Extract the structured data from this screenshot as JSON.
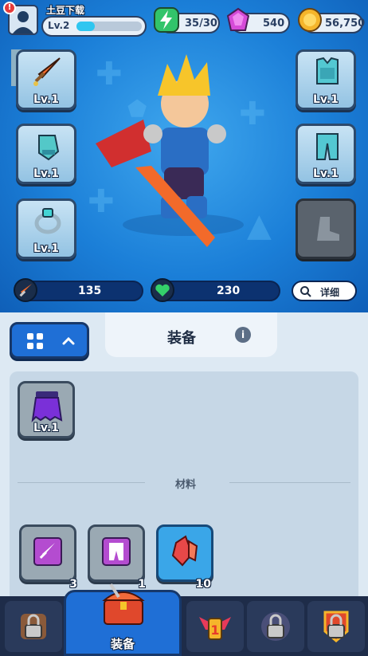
{
  "player": {
    "name": "土豆下载",
    "level_label": "Lv.2",
    "xp_fraction": 0.28,
    "alert_badge": "!"
  },
  "resources": {
    "energy": "35/30",
    "gems": "540",
    "coins": "56,750"
  },
  "equipment_left": [
    {
      "name": "sword",
      "level": "Lv.1"
    },
    {
      "name": "gloves",
      "level": "Lv.1"
    },
    {
      "name": "ring",
      "level": "Lv.1"
    }
  ],
  "equipment_right": [
    {
      "name": "armor",
      "level": "Lv.1"
    },
    {
      "name": "pants",
      "level": "Lv.1"
    },
    {
      "name": "boots-locked",
      "level": ""
    }
  ],
  "stats": {
    "attack": "135",
    "health": "230",
    "details_label": "详细"
  },
  "panel": {
    "tab_title": "装备",
    "info_icon": "i",
    "section_materials": "材料"
  },
  "inventory_equipment": [
    {
      "name": "purple-cape",
      "level": "Lv.1"
    }
  ],
  "inventory_materials": [
    {
      "name": "sword-scroll",
      "count": "3"
    },
    {
      "name": "pants-scroll",
      "count": "1"
    },
    {
      "name": "red-crystal",
      "count": "10"
    }
  ],
  "bottom_nav": {
    "active_label": "装备"
  },
  "colors": {
    "accent_blue": "#1f6fd6",
    "panel_bg": "#dde9f3",
    "nav_bg": "#1e2c49",
    "xp_fill": "#2fc6f0"
  }
}
